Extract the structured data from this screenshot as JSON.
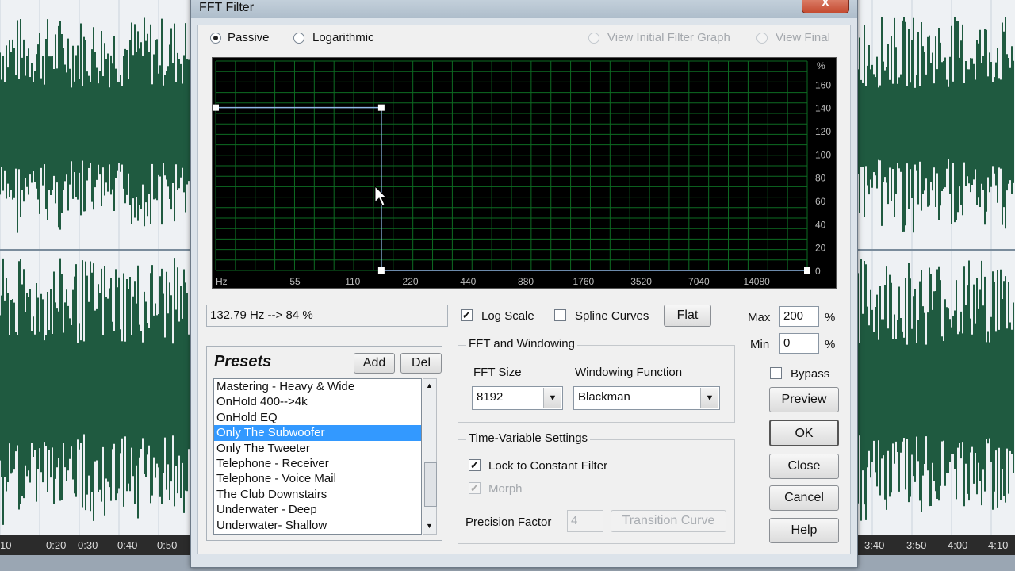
{
  "window": {
    "title": "FFT Filter",
    "close_glyph": "x"
  },
  "mode": {
    "passive_label": "Passive",
    "logarithmic_label": "Logarithmic",
    "view_initial_label": "View Initial Filter Graph",
    "view_final_label": "View Final",
    "selected": "Passive"
  },
  "graph": {
    "y_unit": "%",
    "y_ticks": [
      "160",
      "140",
      "120",
      "100",
      "80",
      "60",
      "40",
      "20",
      "0"
    ],
    "x_unit": "Hz",
    "x_ticks": [
      "55",
      "110",
      "220",
      "440",
      "880",
      "1760",
      "3520",
      "7040",
      "14080"
    ],
    "filter_points": [
      {
        "freq_fraction": 0.0,
        "percent": 140
      },
      {
        "freq_fraction": 0.28,
        "percent": 140
      },
      {
        "freq_fraction": 0.28,
        "percent": 0
      },
      {
        "freq_fraction": 1.0,
        "percent": 0
      }
    ]
  },
  "readout": "132.79 Hz --> 84 %",
  "options": {
    "log_scale_label": "Log Scale",
    "log_scale_checked": true,
    "spline_label": "Spline Curves",
    "spline_checked": false,
    "flat_label": "Flat"
  },
  "range": {
    "max_label": "Max",
    "max_value": "200",
    "min_label": "Min",
    "min_value": "0",
    "unit": "%"
  },
  "bypass": {
    "label": "Bypass",
    "checked": false
  },
  "presets": {
    "title": "Presets",
    "add_label": "Add",
    "del_label": "Del",
    "items": [
      "Mastering - Heavy & Wide",
      "OnHold 400-->4k",
      "OnHold EQ",
      "Only The Subwoofer",
      "Only The Tweeter",
      "Telephone - Receiver",
      "Telephone - Voice Mail",
      "The Club Downstairs",
      "Underwater - Deep",
      "Underwater- Shallow"
    ],
    "selected_index": 3
  },
  "fft": {
    "group_label": "FFT and Windowing",
    "size_label": "FFT Size",
    "size_value": "8192",
    "window_label": "Windowing Function",
    "window_value": "Blackman"
  },
  "timevar": {
    "group_label": "Time-Variable Settings",
    "lock_label": "Lock to Constant Filter",
    "lock_checked": true,
    "morph_label": "Morph",
    "morph_checked": true,
    "precision_label": "Precision Factor",
    "precision_value": "4",
    "transition_label": "Transition Curve"
  },
  "buttons": {
    "preview": "Preview",
    "ok": "OK",
    "close": "Close",
    "cancel": "Cancel",
    "help": "Help"
  },
  "timeline": {
    "left": [
      "10",
      "0:20",
      "0:30",
      "0:40",
      "0:50"
    ],
    "right": [
      "3:40",
      "3:50",
      "4:00",
      "4:10"
    ]
  },
  "colors": {
    "waveform": "#1f5a40",
    "graph_bg": "#000000",
    "grid": "#0d6b22",
    "curve": "#8fb8e6",
    "selection": "#3399ff"
  }
}
